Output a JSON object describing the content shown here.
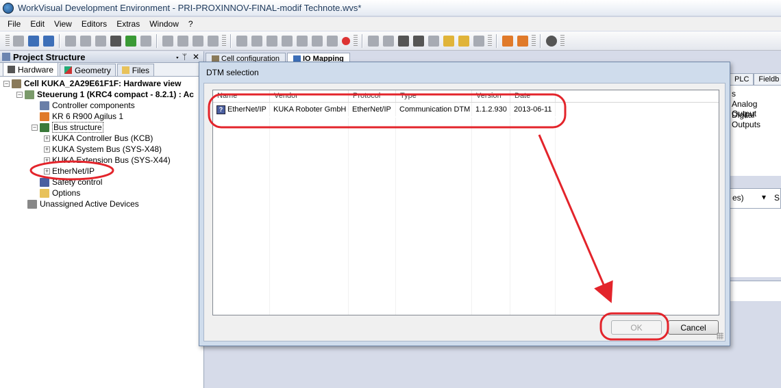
{
  "window": {
    "title": "WorkVisual Development Environment - PRI-PROXINNOV-FINAL-modif Technote.wvs*"
  },
  "menu": [
    "File",
    "Edit",
    "View",
    "Editors",
    "Extras",
    "Window",
    "?"
  ],
  "project_panel": {
    "title": "Project Structure",
    "pin": "▾ ᛘ",
    "close": "✕",
    "tabs": [
      "Hardware",
      "Geometry",
      "Files"
    ],
    "tree": [
      {
        "label": "Cell KUKA_2A29E61F1F: Hardware view"
      },
      {
        "label": "Steuerung 1 (KRC4 compact - 8.2.1) : Ac"
      },
      {
        "label": "Controller components"
      },
      {
        "label": "KR 6 R900 Agilus 1"
      },
      {
        "label": "Bus structure"
      },
      {
        "label": "KUKA Controller Bus (KCB)"
      },
      {
        "label": "KUKA System Bus (SYS-X48)"
      },
      {
        "label": "KUKA Extension Bus (SYS-X44)"
      },
      {
        "label": "EtherNet/IP"
      },
      {
        "label": "Safety control"
      },
      {
        "label": "Options"
      },
      {
        "label": "Unassigned Active Devices"
      }
    ]
  },
  "doc_tabs": [
    "Cell configuration",
    "IO Mapping"
  ],
  "background_right": {
    "tabs": [
      "PLC",
      "Fieldb"
    ],
    "lines": [
      "s",
      "Analog Output",
      "Digital Outputs"
    ],
    "dropdown_text": "es)",
    "dropdown_arrow": "▾",
    "s_label": "S"
  },
  "dialog": {
    "title": "DTM selection",
    "columns": [
      "Name",
      "Vendor",
      "Protocol",
      "Type",
      "Version",
      "Date"
    ],
    "rows": [
      {
        "name": "EtherNet/IP",
        "vendor": "KUKA Roboter GmbH",
        "protocol": "EtherNet/IP",
        "type": "Communication DTM",
        "version": "1.1.2.930",
        "date": "2013-06-11"
      }
    ],
    "row_icon_glyph": "?",
    "ok_label": "OK",
    "cancel_label": "Cancel"
  },
  "colors": {
    "annotation": "#e3242b",
    "accent": "#3d6fb8"
  }
}
